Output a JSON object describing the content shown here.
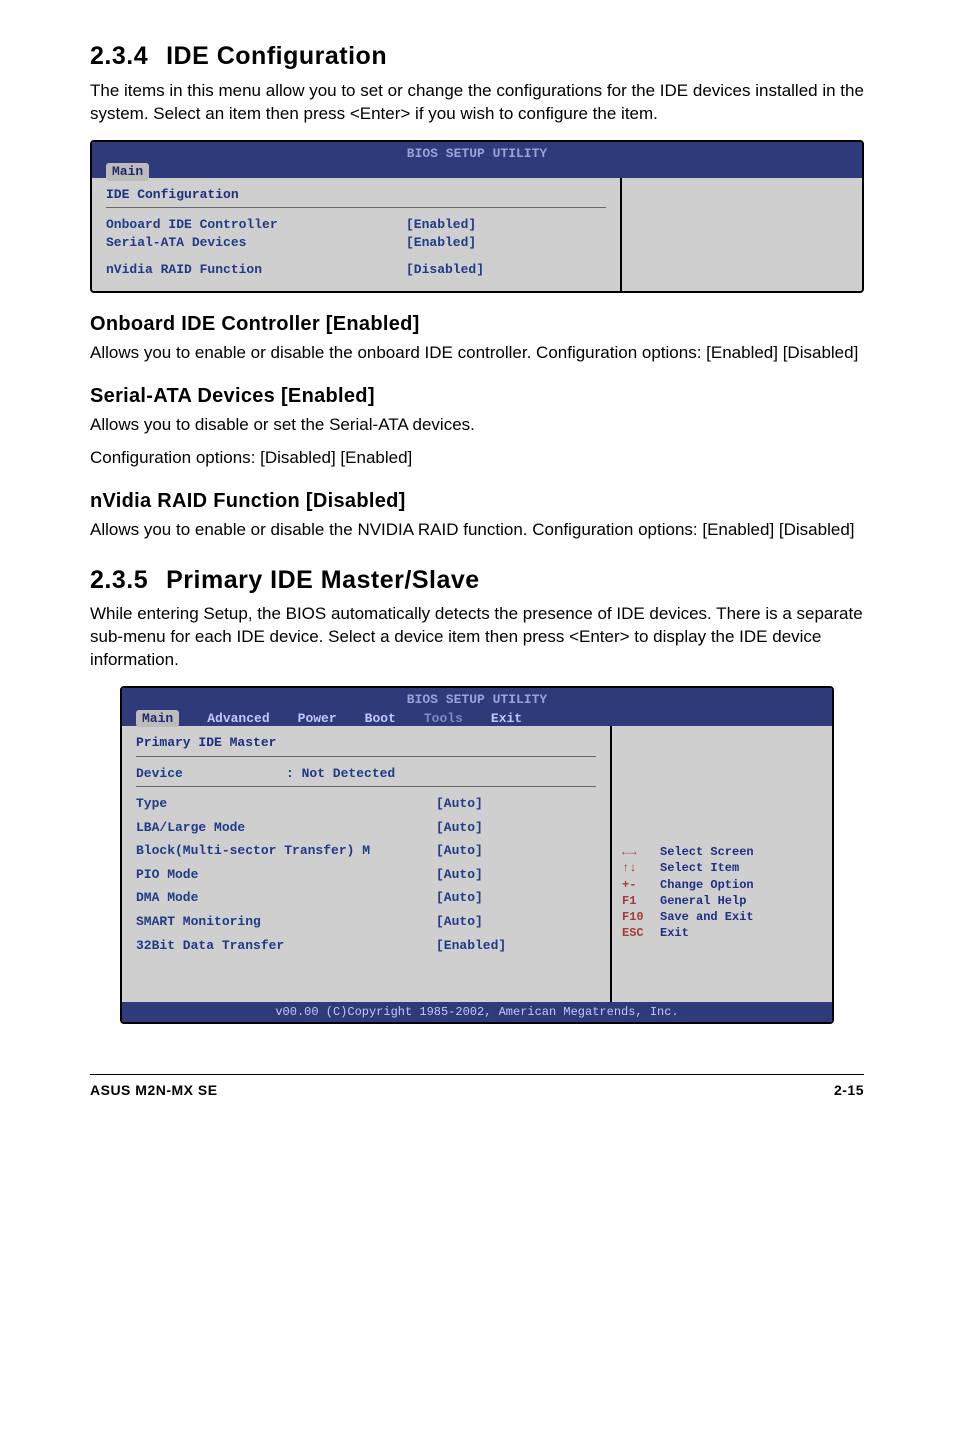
{
  "s234": {
    "heading_num": "2.3.4",
    "heading_title": "IDE Configuration",
    "intro": "The items in this menu allow you to set or change the configurations for the IDE devices installed in the system. Select an item then press <Enter> if you wish to configure the item."
  },
  "bios1": {
    "header_title": "BIOS SETUP UTILITY",
    "tab_main": "Main",
    "section_title": "IDE Configuration",
    "rows": {
      "r0_label": "Onboard IDE Controller",
      "r0_value": "[Enabled]",
      "r1_label": "Serial-ATA Devices",
      "r1_value": "[Enabled]",
      "r2_label": "nVidia RAID Function",
      "r2_value": "[Disabled]"
    }
  },
  "opt_onboard": {
    "heading": "Onboard IDE Controller [Enabled]",
    "desc": "Allows you to enable or disable the onboard IDE controller. Configuration options: [Enabled] [Disabled]"
  },
  "opt_sata": {
    "heading": "Serial-ATA Devices [Enabled]",
    "desc1": "Allows you to disable or set the Serial-ATA devices.",
    "desc2": "Configuration options: [Disabled] [Enabled]"
  },
  "opt_raid": {
    "heading": "nVidia RAID Function [Disabled]",
    "desc": "Allows you to enable or disable the NVIDIA RAID function. Configuration options: [Enabled] [Disabled]"
  },
  "s235": {
    "heading_num": "2.3.5",
    "heading_title": "Primary IDE Master/Slave",
    "intro": "While entering Setup, the BIOS automatically detects the presence of IDE devices. There is a separate sub-menu for each IDE device. Select a device item then press <Enter> to display the IDE device information."
  },
  "bios2": {
    "header_title": "BIOS SETUP UTILITY",
    "tabs": {
      "main": "Main",
      "advanced": "Advanced",
      "power": "Power",
      "boot": "Boot",
      "tools": "Tools",
      "exit": "Exit"
    },
    "section_title": "Primary IDE Master",
    "device_label": "Device",
    "device_value": ": Not Detected",
    "rows": {
      "r0_label": "Type",
      "r0_value": "[Auto]",
      "r1_label": "LBA/Large Mode",
      "r1_value": "[Auto]",
      "r2_label": "Block(Multi-sector Transfer) M",
      "r2_value": "[Auto]",
      "r3_label": "PIO Mode",
      "r3_value": "[Auto]",
      "r4_label": "DMA Mode",
      "r4_value": "[Auto]",
      "r5_label": "SMART Monitoring",
      "r5_value": "[Auto]",
      "r6_label": "32Bit Data Transfer",
      "r6_value": "[Enabled]"
    },
    "legend": {
      "l0_key": "←→",
      "l0_text": "Select Screen",
      "l1_key": "↑↓",
      "l1_text": "Select Item",
      "l2_key": "+-",
      "l2_text": "Change Option",
      "l3_key": "F1",
      "l3_text": "General Help",
      "l4_key": "F10",
      "l4_text": "Save and Exit",
      "l5_key": "ESC",
      "l5_text": "Exit"
    },
    "footer": "v00.00 (C)Copyright 1985-2002, American Megatrends, Inc."
  },
  "page_footer": {
    "left": "ASUS M2N-MX SE",
    "right": "2-15"
  }
}
